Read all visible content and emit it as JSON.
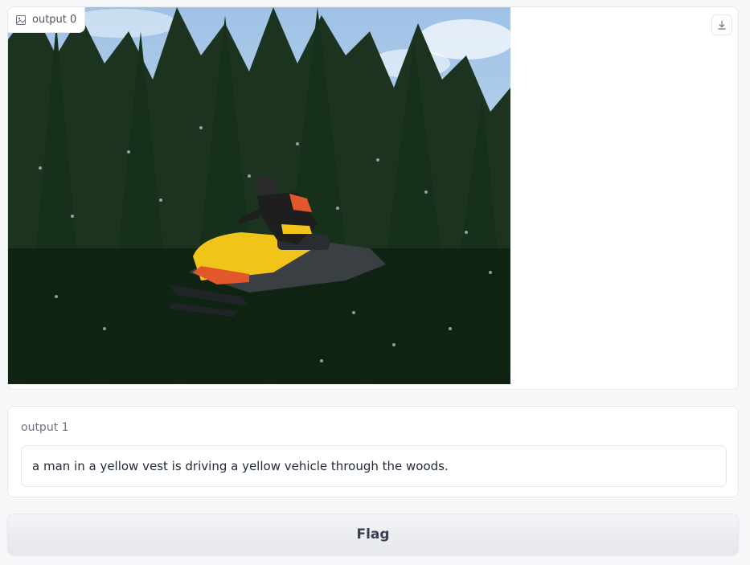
{
  "image_output": {
    "label": "output 0",
    "label_icon": "image-icon",
    "download_icon": "download-icon",
    "image_description_icon": "snowmobile-photo"
  },
  "text_output": {
    "label": "output 1",
    "value": "a man in a yellow vest is driving a yellow vehicle through the woods."
  },
  "flag_button": {
    "label": "Flag"
  },
  "colors": {
    "background": "#f7f8fa",
    "panel_border": "#e5e7eb",
    "text_primary": "#1f2937",
    "text_muted": "#6b7280"
  }
}
